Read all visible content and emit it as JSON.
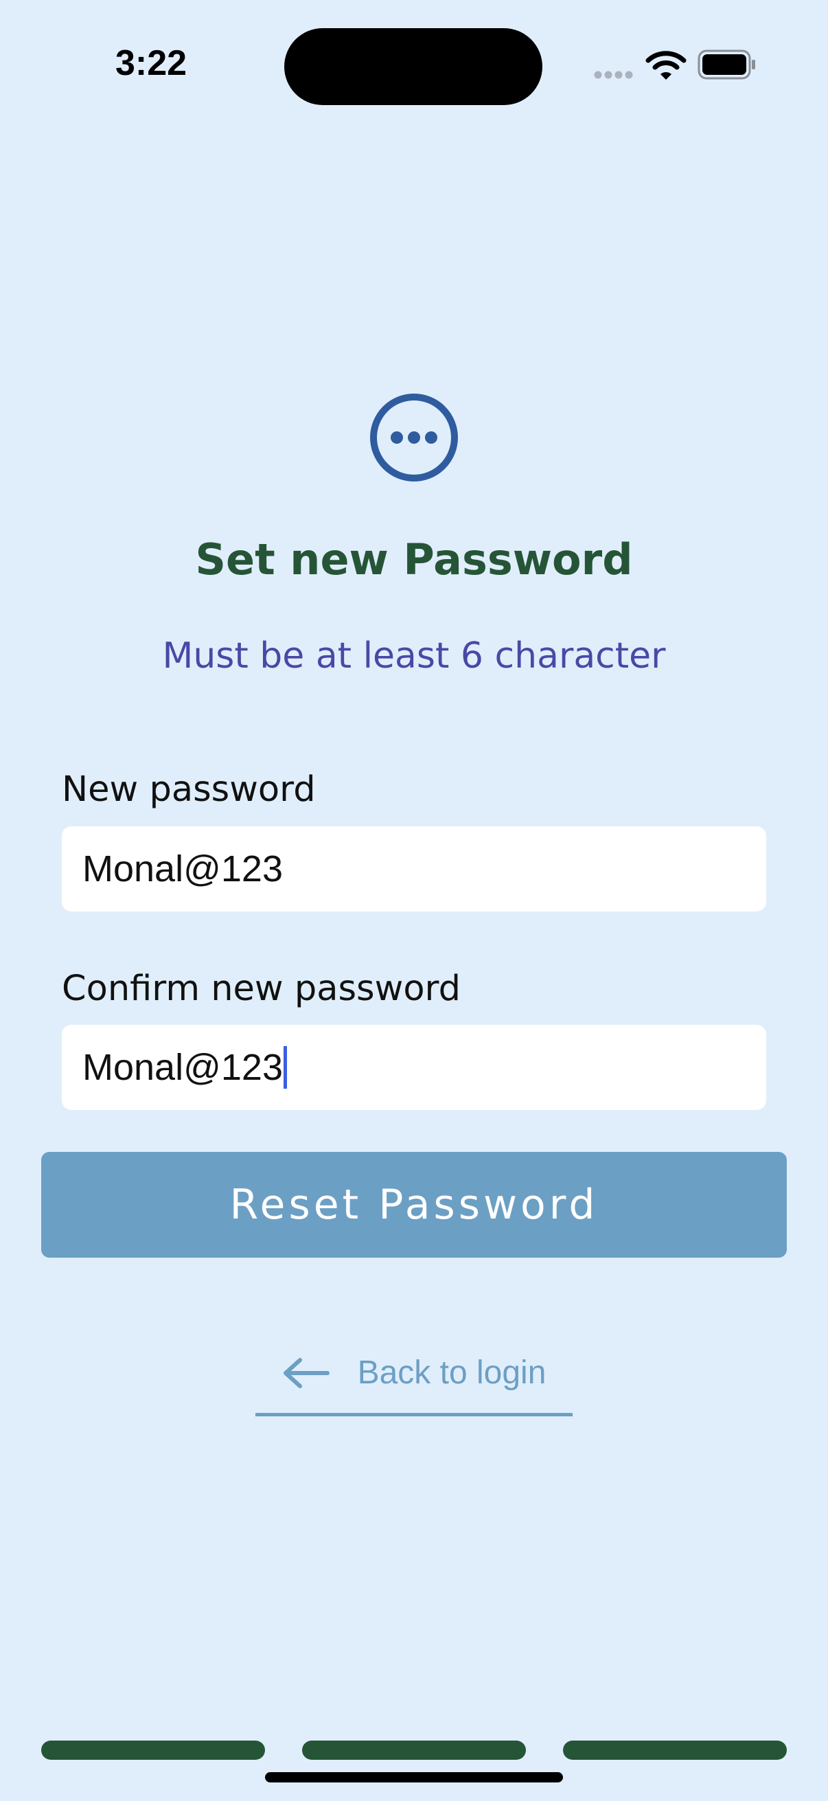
{
  "status_bar": {
    "time": "3:22"
  },
  "header": {
    "icon": "ellipsis-circle-icon",
    "title": "Set new Password",
    "subtitle": "Must be at least 6 character"
  },
  "form": {
    "new_password": {
      "label": "New password",
      "value": "Monal@123"
    },
    "confirm_password": {
      "label": "Confirm new password",
      "value": "Monal@123"
    },
    "submit_label": "Reset Password"
  },
  "back_link": {
    "icon": "arrow-left-icon",
    "label": "Back to login"
  },
  "colors": {
    "background": "#e0eefb",
    "title": "#255536",
    "subtitle": "#4a48a6",
    "button": "#6c9fc4",
    "icon": "#2f5c9e",
    "progress": "#255536"
  }
}
